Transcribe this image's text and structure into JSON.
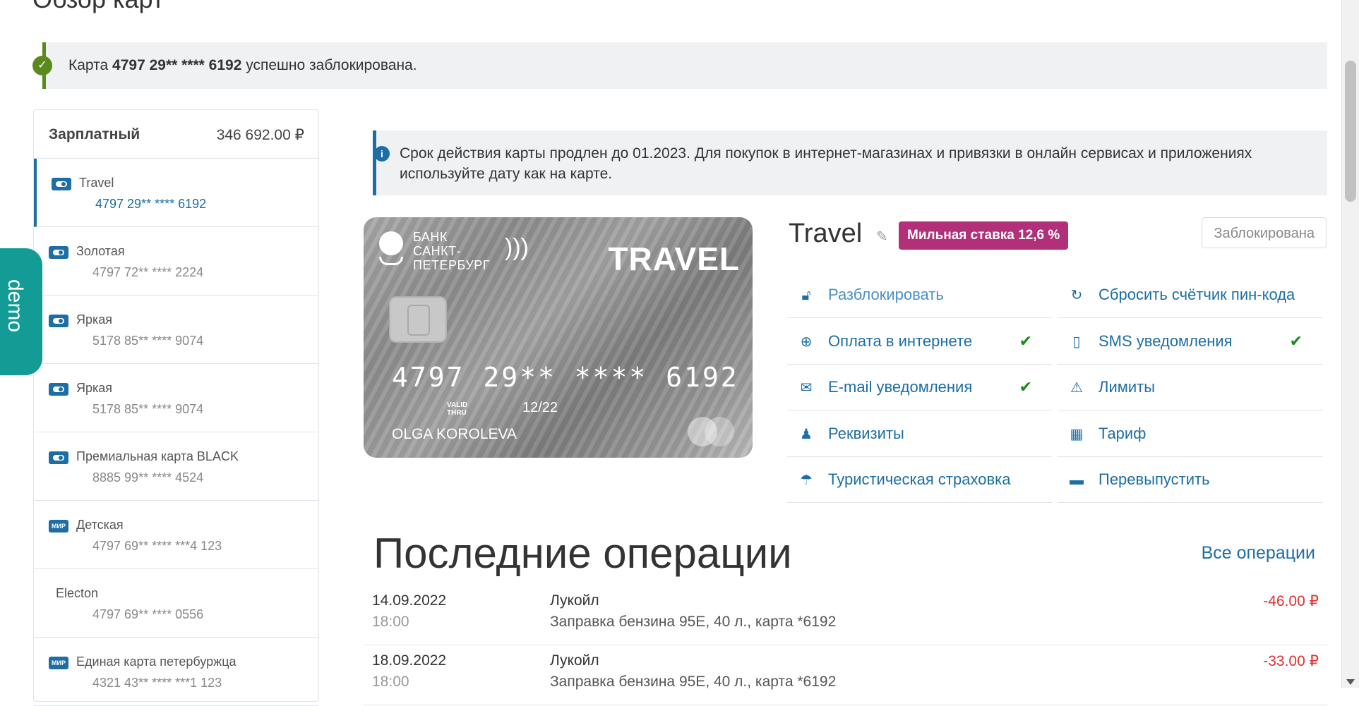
{
  "page": {
    "title": "Обзор карт"
  },
  "success_alert": {
    "prefix": "Карта",
    "card_number": "4797 29** **** 6192",
    "suffix": "успешно заблокирована."
  },
  "account": {
    "name": "Зарплатный",
    "amount": "346 692.00 ₽"
  },
  "cards": [
    {
      "name": "Travel",
      "number": "4797 29** **** 6192",
      "icon": "card-toggle-icon",
      "active": true
    },
    {
      "name": "Золотая",
      "number": "4797 72** **** 2224",
      "icon": "card-toggle-icon"
    },
    {
      "name": "Яркая",
      "number": "5178 85** **** 9074",
      "icon": "card-toggle-icon"
    },
    {
      "name": "Яркая",
      "number": "5178 85** **** 9074",
      "icon": "card-toggle-icon"
    },
    {
      "name": "Премиальная карта BLACK",
      "number": "8885 99** **** 4524",
      "icon": "card-toggle-icon"
    },
    {
      "name": "Детская",
      "number": "4797 69** **** ***4 123",
      "icon": "mir-icon",
      "icon_text": "МИР"
    },
    {
      "name": "Electon",
      "number": "4797 69** **** 0556",
      "icon": ""
    },
    {
      "name": "Единая карта петербуржца",
      "number": "4321 43** **** ***1 123",
      "icon": "mir-icon",
      "icon_text": "МИР"
    }
  ],
  "demo_tab": {
    "label": "demo"
  },
  "info_alert": {
    "text": "Срок действия карты продлен до 01.2023. Для покупок в интернет-магазинах и привязки в онлайн сервисах и приложениях используйте дату как на карте."
  },
  "bank_card": {
    "bank_name_1": "БАНК",
    "bank_name_2": "САНКТ-",
    "bank_name_3": "ПЕТЕРБУРГ",
    "brand": "TRAVEL",
    "number": "4797 29** **** 6192",
    "valid_1": "VALID",
    "valid_2": "THRU",
    "expiry": "12/22",
    "holder": "OLGA KOROLEVA"
  },
  "card_detail": {
    "title": "Travel",
    "mile_badge": "Мильная ставка 12,6 %",
    "status": "Заблокирована"
  },
  "actions": [
    {
      "label": "Разблокировать",
      "icon": "unlock-icon",
      "checked": false
    },
    {
      "label": "Сбросить счётчик пин-кода",
      "icon": "refresh-icon",
      "checked": false
    },
    {
      "label": "Оплата в интернете",
      "icon": "globe-icon",
      "checked": true
    },
    {
      "label": "SMS уведомления",
      "icon": "phone-icon",
      "checked": true
    },
    {
      "label": "E-mail уведомления",
      "icon": "envelope-icon",
      "checked": true
    },
    {
      "label": "Лимиты",
      "icon": "warning-icon",
      "checked": false
    },
    {
      "label": "Реквизиты",
      "icon": "user-icon",
      "checked": false
    },
    {
      "label": "Тариф",
      "icon": "calculator-icon",
      "checked": false
    },
    {
      "label": "Туристическая страховка",
      "icon": "umbrella-icon",
      "checked": false
    },
    {
      "label": "Перевыпустить",
      "icon": "id-card-icon",
      "checked": false
    }
  ],
  "operations": {
    "title": "Последние операции",
    "all_link": "Все операции",
    "rows": [
      {
        "date": "14.09.2022",
        "time": "18:00",
        "merchant": "Лукойл",
        "description": "Заправка бензина 95Е, 40 л., карта *6192",
        "amount": "-46.00 ₽"
      },
      {
        "date": "18.09.2022",
        "time": "18:00",
        "merchant": "Лукойл",
        "description": "Заправка бензина 95Е, 40 л., карта *6192",
        "amount": "-33.00 ₽"
      }
    ]
  },
  "colors": {
    "accent": "#1c6ea4",
    "success": "#5a8a1f",
    "badge": "#b22f7a",
    "negative": "#e03030",
    "demo": "#139b95"
  }
}
